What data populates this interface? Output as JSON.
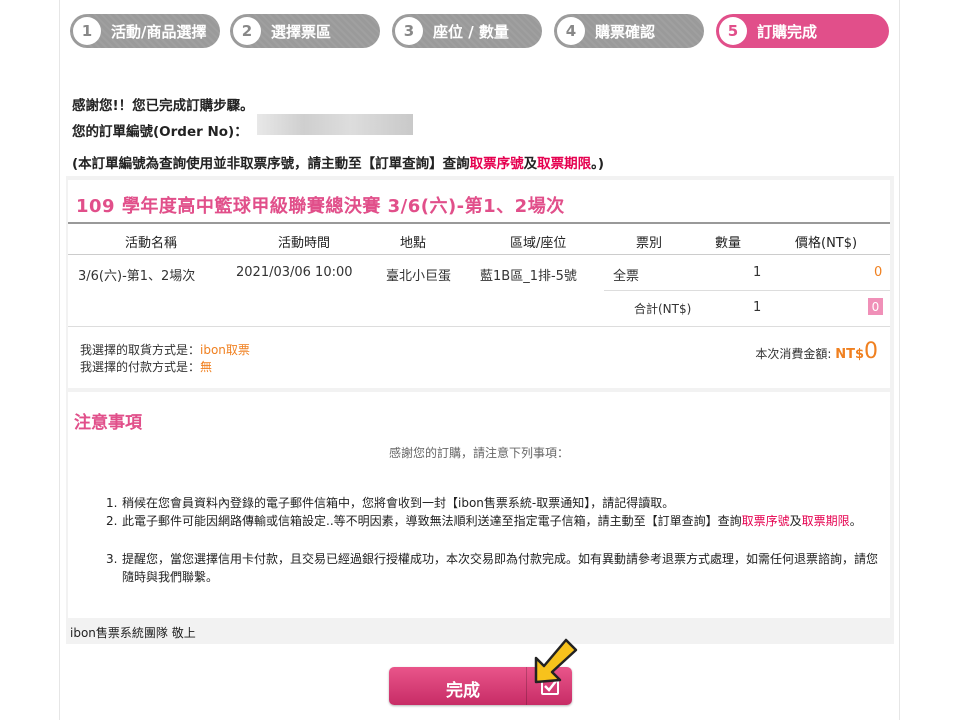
{
  "steps": [
    {
      "num": "1",
      "label": "活動/商品選擇"
    },
    {
      "num": "2",
      "label": "選擇票區"
    },
    {
      "num": "3",
      "label": "座位 / 數量"
    },
    {
      "num": "4",
      "label": "購票確認"
    },
    {
      "num": "5",
      "label": "訂購完成"
    }
  ],
  "thanks": {
    "line1": "感謝您!！您已完成訂購步驟。",
    "line2": "您的訂單編號(Order No)：",
    "line3_a": "(本訂單編號為查詢使用並非取票序號，請主動至【訂單查詢】查詢",
    "line3_b": "取票序號",
    "line3_c": "及",
    "line3_d": "取票期限",
    "line3_e": "。)"
  },
  "event": {
    "title": "109 學年度高中籃球甲級聯賽總決賽 3/6(六)-第1、2場次",
    "headers": [
      "活動名稱",
      "活動時間",
      "地點",
      "區域/座位",
      "票別",
      "數量",
      "價格(NT$)"
    ],
    "row": {
      "name": "3/6(六)-第1、2場次",
      "time": "2021/03/06 10:00",
      "venue": "臺北小巨蛋",
      "seat": "藍1B區_1排-5號",
      "ticket_type": "全票",
      "qty": "1",
      "price": "0"
    },
    "subtotal": {
      "label": "合計(NT$)",
      "qty": "1",
      "price": "0"
    },
    "pickup_label": "我選擇的取貨方式是：",
    "pickup_value": "ibon取票",
    "payment_label": "我選擇的付款方式是：",
    "payment_value": "無",
    "total_label": "本次消費金額:",
    "total_currency": "NT$",
    "total_value": "0"
  },
  "notice": {
    "title": "注意事項",
    "subtitle": "感謝您的訂購，請注意下列事項：",
    "items": [
      {
        "n": "1.",
        "text": "稍候在您會員資料內登錄的電子郵件信箱中，您將會收到一封【ibon售票系統-取票通知】，請記得讀取。"
      },
      {
        "n": "2.",
        "text_a": "此電子郵件可能因網路傳輸或信箱設定..等不明因素，導致無法順利送達至指定電子信箱，請主動至【訂單查詢】查詢",
        "text_b": "取票序號",
        "text_c": "及",
        "text_d": "取票期限",
        "text_e": "。"
      },
      {
        "n": "3.",
        "text": "提醒您，當您選擇信用卡付款，且交易已經過銀行授權成功，本次交易即為付款完成。如有異動請參考退票方式處理，如需任何退票諮詢，請您隨時與我們聯繫。"
      }
    ]
  },
  "signature": "ibon售票系統團隊 敬上",
  "done_button": {
    "label": "完成"
  },
  "colors": {
    "accent": "#e14f8a",
    "inactive_step": "#9a9a9a",
    "highlight": "#f08020",
    "red_link": "#e5004f"
  }
}
